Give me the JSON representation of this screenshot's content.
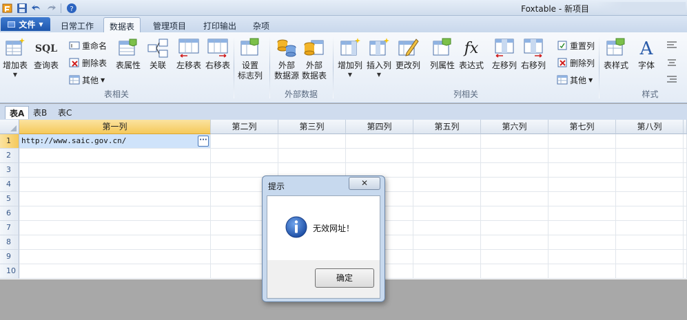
{
  "window": {
    "title": "Foxtable - 新项目"
  },
  "ribbon_tabs": {
    "file": "文件",
    "items": [
      "日常工作",
      "数据表",
      "管理项目",
      "打印输出",
      "杂项"
    ],
    "active": "数据表"
  },
  "ribbon": {
    "add_table": "增加表",
    "query_table": "查询表",
    "rename": "重命名",
    "delete_table": "删除表",
    "other1": "其他",
    "table_props": "表属性",
    "relation": "关联",
    "move_table_left": "左移表",
    "move_table_right": "右移表",
    "set_flag_col_1": "设置",
    "set_flag_col_2": "标志列",
    "group_table": "表相关",
    "ext_source_1": "外部",
    "ext_source_2": "数据源",
    "ext_table_1": "外部",
    "ext_table_2": "数据表",
    "group_external": "外部数据",
    "add_col": "增加列",
    "insert_col": "插入列",
    "change_col": "更改列",
    "col_props": "列属性",
    "expression": "表达式",
    "move_col_left": "左移列",
    "move_col_right": "右移列",
    "reset_col": "重置列",
    "delete_col": "删除列",
    "other2": "其他",
    "group_column": "列相关",
    "table_style": "表样式",
    "font": "字体",
    "group_style": "样式",
    "sql_icon_text": "SQL",
    "fx_icon_text": "fx",
    "font_icon_text": "A",
    "colors": {
      "accent": "#2a5caa",
      "file_tab": "#1f57ad"
    }
  },
  "sheets": {
    "tabs": [
      "表A",
      "表B",
      "表C"
    ],
    "active": "表A"
  },
  "grid": {
    "columns": [
      "第一列",
      "第二列",
      "第三列",
      "第四列",
      "第五列",
      "第六列",
      "第七列",
      "第八列"
    ],
    "rows": [
      "1",
      "2",
      "3",
      "4",
      "5",
      "6",
      "7",
      "8",
      "9",
      "10"
    ],
    "cell_r1_c1": "http://www.saic.gov.cn/",
    "ellipsis": "···"
  },
  "dialog": {
    "title": "提示",
    "close": "✕",
    "message": "无效网址！",
    "ok": "确定",
    "icon": "info-icon"
  }
}
